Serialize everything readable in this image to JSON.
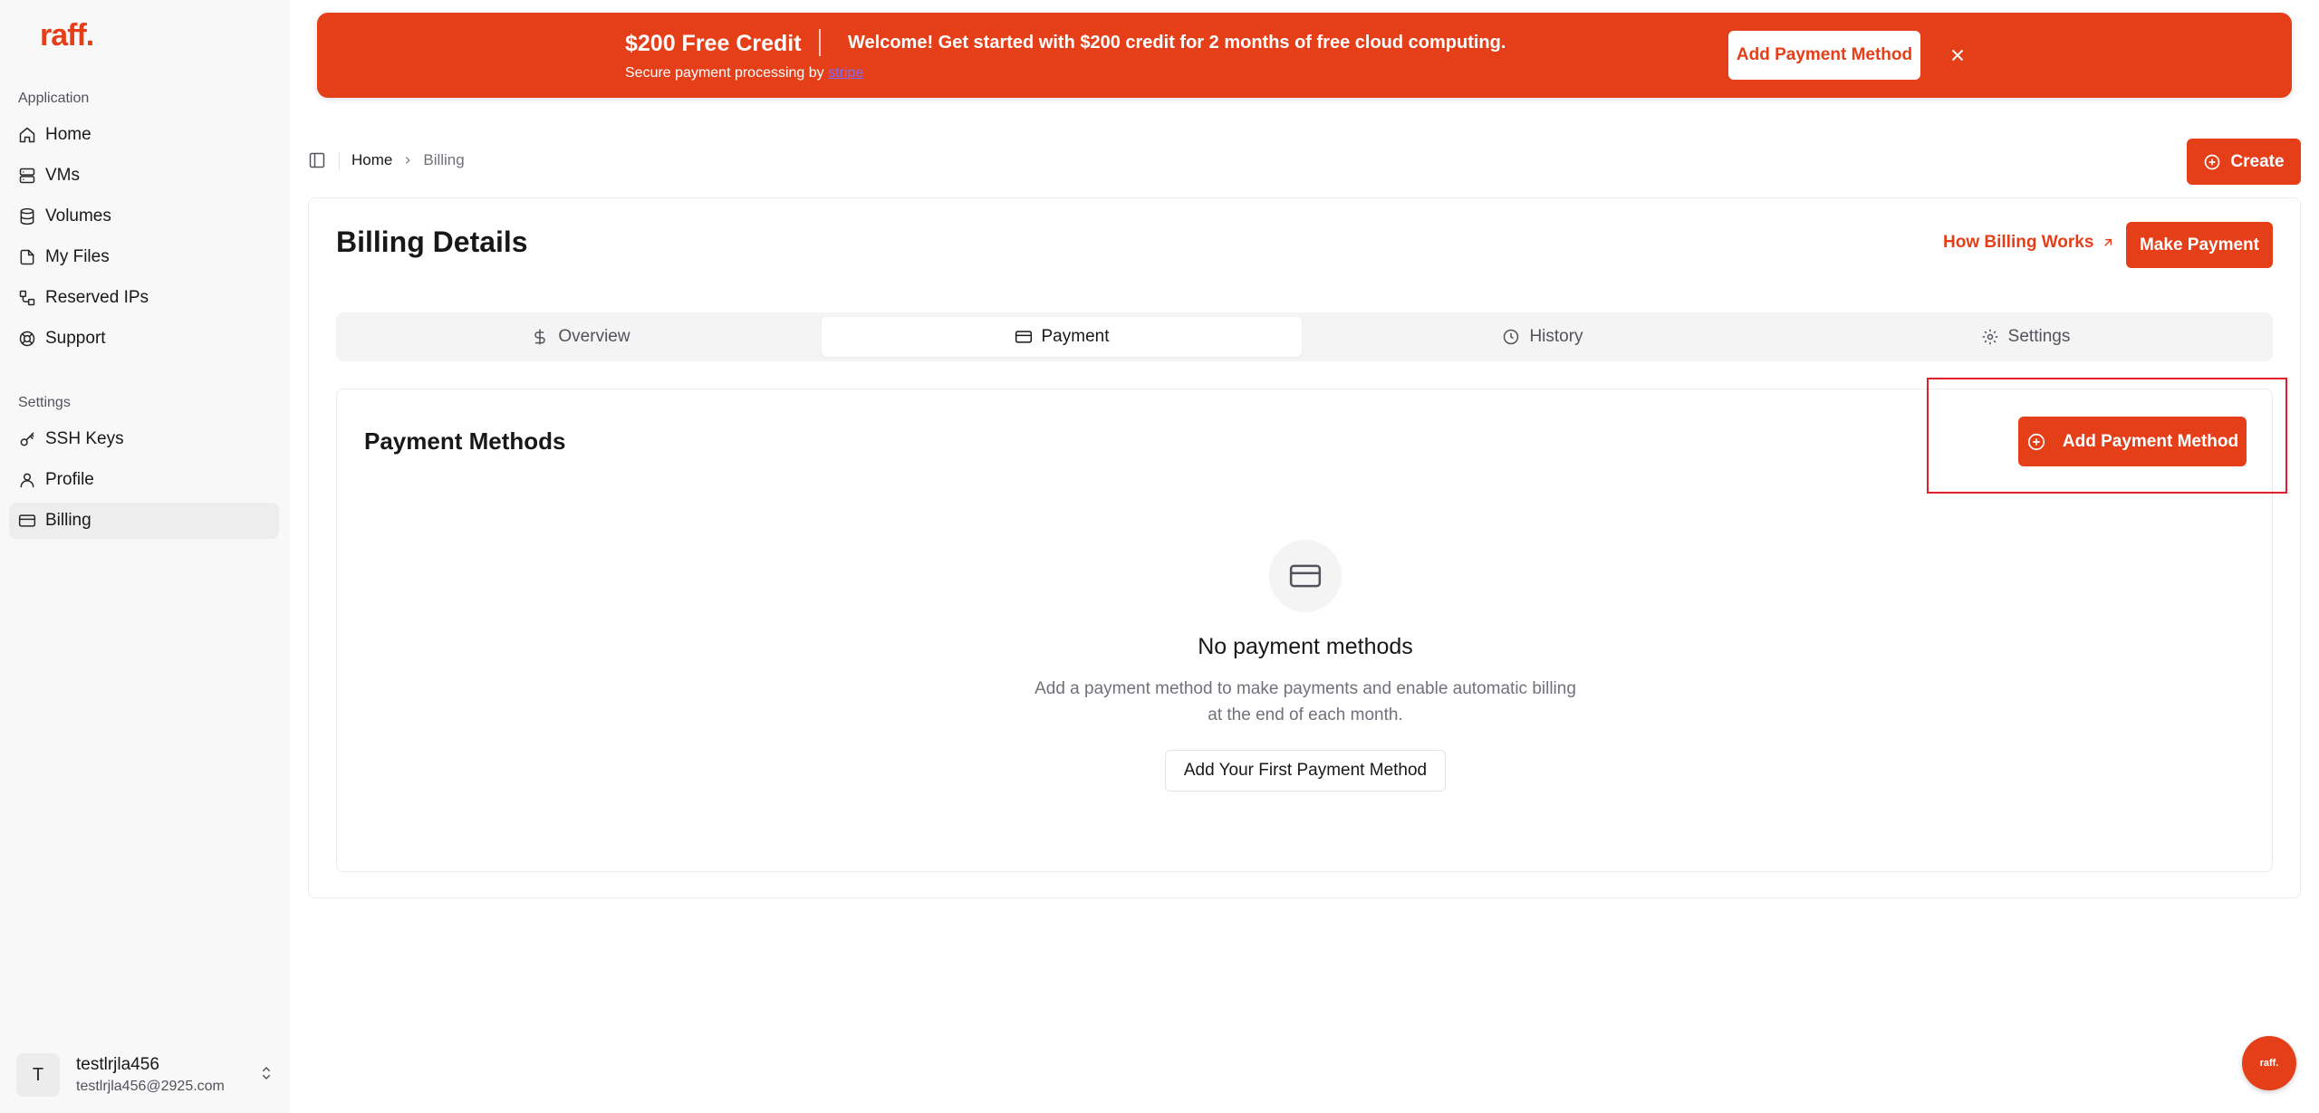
{
  "brand": {
    "logo_text": "raff.",
    "accent_color": "#e53f1a"
  },
  "sidebar": {
    "groups": [
      {
        "label": "Application",
        "items": [
          {
            "label": "Home",
            "icon": "home-icon"
          },
          {
            "label": "VMs",
            "icon": "server-icon"
          },
          {
            "label": "Volumes",
            "icon": "database-icon"
          },
          {
            "label": "My Files",
            "icon": "file-icon"
          },
          {
            "label": "Reserved IPs",
            "icon": "network-icon"
          },
          {
            "label": "Support",
            "icon": "lifebuoy-icon"
          }
        ]
      },
      {
        "label": "Settings",
        "items": [
          {
            "label": "SSH Keys",
            "icon": "key-icon"
          },
          {
            "label": "Profile",
            "icon": "user-icon"
          },
          {
            "label": "Billing",
            "icon": "credit-card-icon",
            "active": true
          }
        ]
      }
    ],
    "user": {
      "initial": "T",
      "name": "testlrjla456",
      "email": "testlrjla456@2925.com"
    }
  },
  "banner": {
    "title": "$200 Free Credit",
    "subtitle_prefix": "Secure payment processing by",
    "subtitle_link": "stripe",
    "message": "Welcome! Get started with $200 credit for 2 months of free cloud computing.",
    "button_label": "Add Payment Method"
  },
  "header": {
    "breadcrumb": {
      "home": "Home",
      "current": "Billing"
    },
    "create_label": "Create"
  },
  "main": {
    "title": "Billing Details",
    "how_link": "How Billing Works",
    "make_payment_label": "Make Payment",
    "tabs": [
      {
        "label": "Overview",
        "icon": "dollar-icon"
      },
      {
        "label": "Payment",
        "icon": "credit-card-icon",
        "active": true
      },
      {
        "label": "History",
        "icon": "clock-icon"
      },
      {
        "label": "Settings",
        "icon": "gear-icon"
      }
    ],
    "payment_methods": {
      "title": "Payment Methods",
      "add_label": "Add Payment Method",
      "empty_title": "No payment methods",
      "empty_desc": "Add a payment method to make payments and enable automatic billing at the end of each month.",
      "first_button": "Add Your First Payment Method"
    }
  },
  "fab": {
    "label": "raff."
  }
}
